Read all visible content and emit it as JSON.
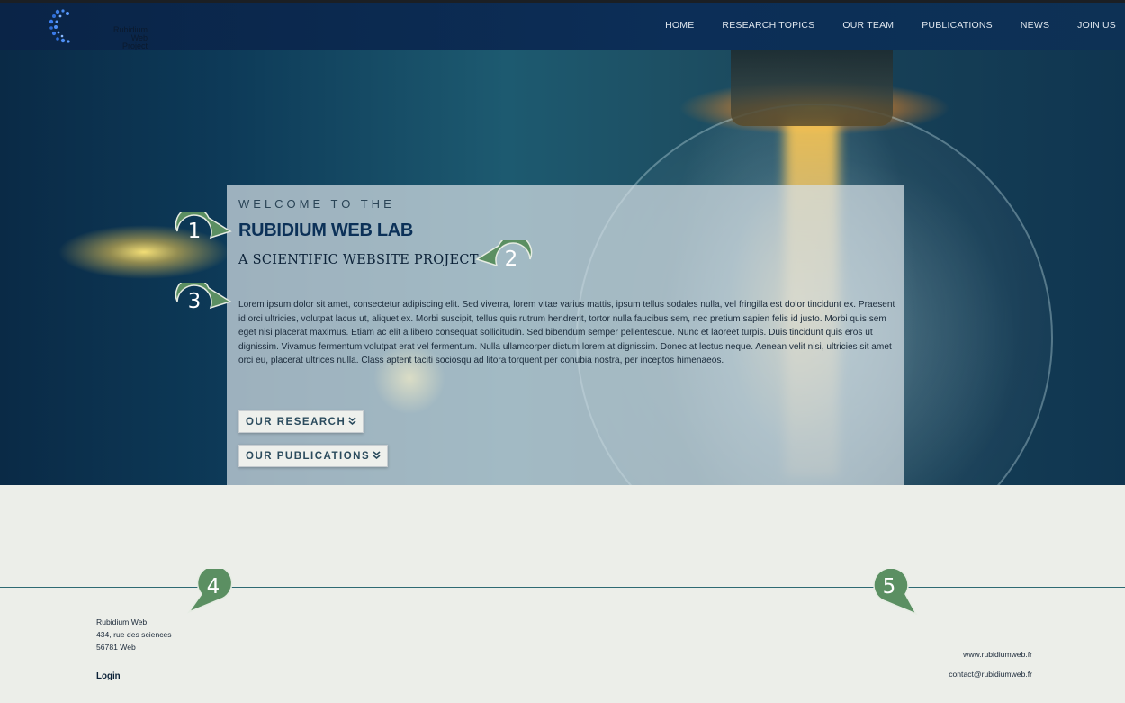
{
  "brand": {
    "name_line1": "Rubidium Web",
    "name_line2": "Project",
    "logo_icon": "molecule-dots-icon"
  },
  "nav": {
    "items": [
      {
        "label": "HOME"
      },
      {
        "label": "RESEARCH TOPICS"
      },
      {
        "label": "OUR TEAM"
      },
      {
        "label": "PUBLICATIONS"
      },
      {
        "label": "NEWS"
      },
      {
        "label": "JOIN US"
      }
    ]
  },
  "hero": {
    "welcome": "WELCOME TO THE",
    "title": "RUBIDIUM WEB LAB",
    "subtitle": "A SCIENTIFIC WEBSITE PROJECT",
    "body": "Lorem ipsum dolor sit amet, consectetur adipiscing elit. Sed viverra, lorem vitae varius mattis, ipsum tellus sodales nulla, vel fringilla est dolor tincidunt ex. Praesent id orci ultricies, volutpat lacus ut, aliquet ex. Morbi suscipit, tellus quis rutrum hendrerit, tortor nulla faucibus sem, nec pretium sapien felis id justo. Morbi quis sem eget nisi placerat maximus. Etiam ac elit a libero consequat sollicitudin. Sed bibendum semper pellentesque. Nunc et laoreet turpis. Duis tincidunt quis eros ut dignissim. Vivamus fermentum volutpat erat vel fermentum. Nulla ullamcorper dictum lorem at dignissim. Donec at lectus neque. Aenean velit nisi, ultricies sit amet orci eu, placerat ultrices nulla. Class aptent taciti sociosqu ad litora torquent per conubia nostra, per inceptos himenaeos.",
    "btn_research": "OUR RESEARCH",
    "btn_publications": "OUR PUBLICATIONS",
    "chevron": "»"
  },
  "callouts": [
    "1",
    "2",
    "3",
    "4",
    "5"
  ],
  "footer": {
    "address_line1": "Rubidium Web",
    "address_line2": "434, rue des sciences",
    "address_line3": "56781 Web",
    "login": "Login",
    "website": "www.rubidiumweb.fr",
    "email": "contact@rubidiumweb.fr"
  },
  "colors": {
    "nav_bg": "#0c2e57",
    "title": "#0c3158",
    "callout": "#5b8f62",
    "footer_bg": "#eceee9",
    "rule": "#2e6a73"
  }
}
